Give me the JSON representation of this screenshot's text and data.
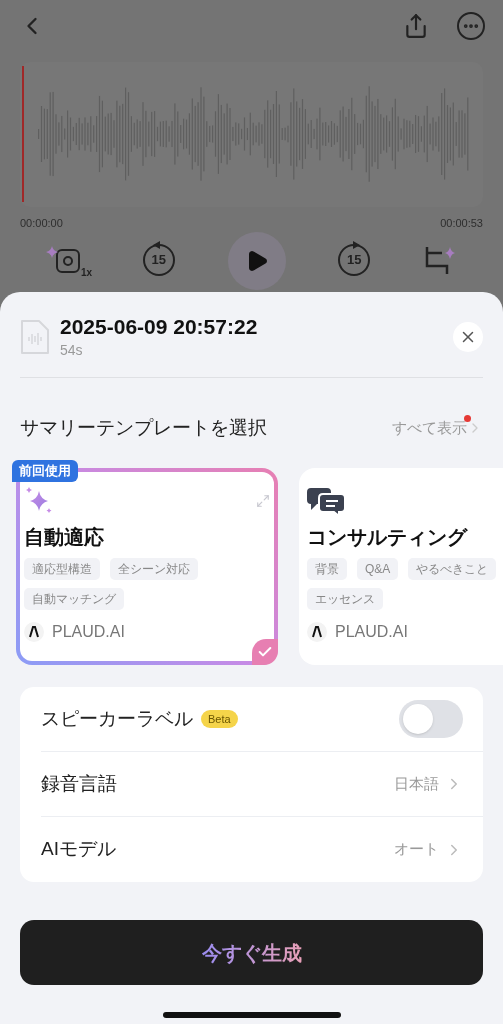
{
  "player": {
    "start_time": "00:00:00",
    "end_time": "00:00:53",
    "speed_label": "1x",
    "rewind_label": "15",
    "forward_label": "15"
  },
  "sheet": {
    "title": "2025-06-09 20:57:22",
    "duration": "54s",
    "section_title": "サマリーテンプレートを選択",
    "show_all": "すべて表示",
    "show_all_new": true,
    "templates": [
      {
        "kind": "sparkle",
        "name": "自動適応",
        "badge": "前回使用",
        "selected": true,
        "tags": [
          "適応型構造",
          "全シーン対応",
          "自動マッチング"
        ],
        "author": "PLAUD.AI"
      },
      {
        "kind": "chat",
        "name": "コンサルティング",
        "selected": false,
        "tags": [
          "背景",
          "Q&A",
          "やるべきこと",
          "エッセンス"
        ],
        "author": "PLAUD.AI"
      }
    ],
    "settings": [
      {
        "kind": "toggle",
        "label": "スピーカーラベル",
        "badge": "Beta",
        "on": false
      },
      {
        "kind": "link",
        "label": "録音言語",
        "value": "日本語"
      },
      {
        "kind": "link",
        "label": "AIモデル",
        "value": "オート"
      }
    ],
    "generate_button": "今すぐ生成"
  }
}
